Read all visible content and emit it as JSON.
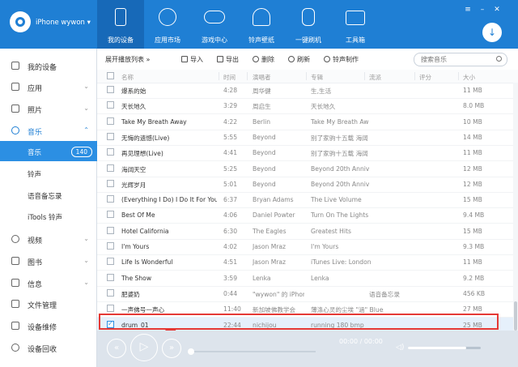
{
  "app": {
    "brand_name": "iPhone wywon ▾",
    "window_buttons": [
      "≡",
      "–",
      "✕"
    ],
    "download_icon": "↓"
  },
  "nav": {
    "items": [
      {
        "label": "我的设备",
        "icon": "phone-icon",
        "active": true
      },
      {
        "label": "应用市场",
        "icon": "apps-icon",
        "active": false
      },
      {
        "label": "游戏中心",
        "icon": "gamepad-icon",
        "active": false
      },
      {
        "label": "铃声壁纸",
        "icon": "bell-icon",
        "active": false
      },
      {
        "label": "一键刷机",
        "icon": "flash-icon",
        "active": false
      },
      {
        "label": "工具箱",
        "icon": "toolbox-icon",
        "active": false
      }
    ]
  },
  "sidebar": {
    "items": [
      {
        "label": "我的设备",
        "icon": "device-icon",
        "chevron": ""
      },
      {
        "label": "应用",
        "icon": "apps-grid-icon",
        "chevron": "⌄"
      },
      {
        "label": "照片",
        "icon": "photo-icon",
        "chevron": "⌄"
      },
      {
        "label": "音乐",
        "icon": "music-icon",
        "chevron": "⌃"
      }
    ],
    "music_sub": [
      {
        "label": "音乐",
        "badge": "140",
        "active": true
      },
      {
        "label": "铃声",
        "badge": "",
        "active": false
      },
      {
        "label": "语音备忘录",
        "badge": "",
        "active": false
      },
      {
        "label": "iTools 铃声",
        "badge": "",
        "active": false
      }
    ],
    "items_after": [
      {
        "label": "视频",
        "icon": "video-icon",
        "chevron": "⌄"
      },
      {
        "label": "图书",
        "icon": "book-icon",
        "chevron": "⌄"
      },
      {
        "label": "信息",
        "icon": "message-icon",
        "chevron": "⌄"
      },
      {
        "label": "文件管理",
        "icon": "folder-icon",
        "chevron": ""
      },
      {
        "label": "设备维修",
        "icon": "repair-icon",
        "chevron": ""
      },
      {
        "label": "设备回收",
        "icon": "recycle-icon",
        "chevron": ""
      }
    ]
  },
  "toolbar": {
    "playlist": "展开播放列表 »",
    "import": "导入",
    "export": "导出",
    "delete": "删除",
    "refresh": "刷新",
    "ringtone": "铃声制作",
    "search_placeholder": "搜索音乐"
  },
  "table": {
    "headers": [
      "名称",
      "时间",
      "演唱者",
      "专辑",
      "流派",
      "评分",
      "大小"
    ],
    "rows": [
      {
        "name": "爆系的始",
        "time": "4:28",
        "artist": "周华健",
        "album": "生,生活",
        "genre": "",
        "size": "11 MB",
        "checked": false
      },
      {
        "name": "天长地久",
        "time": "3:29",
        "artist": "周启生",
        "album": "天长地久",
        "genre": "",
        "size": "8.0 MB",
        "checked": false
      },
      {
        "name": "Take My Breath Away",
        "time": "4:22",
        "artist": "Berlin",
        "album": "Take My Breath Aw",
        "genre": "",
        "size": "10 MB",
        "checked": false
      },
      {
        "name": "无悔的遗憾(Live)",
        "time": "5:55",
        "artist": "Beyond",
        "album": "别了家驹十五载 海阔",
        "genre": "",
        "size": "14 MB",
        "checked": false
      },
      {
        "name": "再见理想(Live)",
        "time": "4:41",
        "artist": "Beyond",
        "album": "别了家驹十五载 海阔",
        "genre": "",
        "size": "11 MB",
        "checked": false
      },
      {
        "name": "海阔天空",
        "time": "5:25",
        "artist": "Beyond",
        "album": "Beyond 20th Anniv",
        "genre": "",
        "size": "12 MB",
        "checked": false
      },
      {
        "name": "光辉岁月",
        "time": "5:01",
        "artist": "Beyond",
        "album": "Beyond 20th Anniv",
        "genre": "",
        "size": "12 MB",
        "checked": false
      },
      {
        "name": "(Everything I Do) I Do It For You",
        "time": "6:37",
        "artist": "Bryan Adams",
        "album": "The Live Volume",
        "genre": "",
        "size": "15 MB",
        "checked": false
      },
      {
        "name": "Best Of Me",
        "time": "4:06",
        "artist": "Daniel Powter",
        "album": "Turn On The Lights",
        "genre": "",
        "size": "9.4 MB",
        "checked": false
      },
      {
        "name": "Hotel California",
        "time": "6:30",
        "artist": "The Eagles",
        "album": "Greatest Hits",
        "genre": "",
        "size": "15 MB",
        "checked": false
      },
      {
        "name": "I'm Yours",
        "time": "4:02",
        "artist": "Jason Mraz",
        "album": "I'm Yours",
        "genre": "",
        "size": "9.3 MB",
        "checked": false
      },
      {
        "name": "Life Is Wonderful",
        "time": "4:51",
        "artist": "Jason Mraz",
        "album": "iTunes Live: London",
        "genre": "",
        "size": "11 MB",
        "checked": false
      },
      {
        "name": "The Show",
        "time": "3:59",
        "artist": "Lenka",
        "album": "Lenka",
        "genre": "",
        "size": "9.2 MB",
        "checked": false
      },
      {
        "name": "肥婆奶",
        "time": "0:44",
        "artist": "\"wywon\" 的 iPhon",
        "album": "",
        "genre": "语音备忘录",
        "size": "456 KB",
        "checked": false
      },
      {
        "name": "一声佛号一声心",
        "time": "11:40",
        "artist": "新加坡佛教学会",
        "album": "薄涤心灵的尘埃 \"涵\" Blues",
        "genre": "",
        "size": "27 MB",
        "checked": false
      },
      {
        "name": "drum_01",
        "time": "22:44",
        "artist": "nichijou",
        "album": "running 180 bmp",
        "genre": "",
        "size": "25 MB",
        "checked": true
      }
    ]
  },
  "player": {
    "time": "00:00 / 00:00",
    "prev_icon": "«",
    "play_icon": "▷",
    "next_icon": "»",
    "volume_icon": "◁)",
    "volume_level": 0.8
  }
}
